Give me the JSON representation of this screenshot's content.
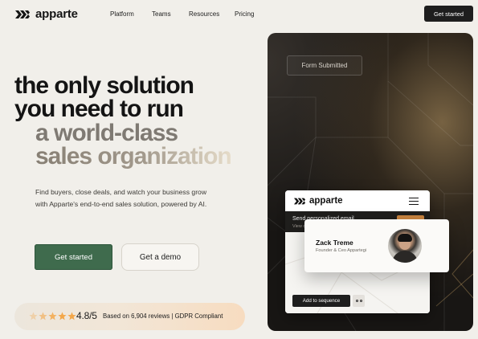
{
  "nav": {
    "brand": "apparte",
    "links": [
      "Platform",
      "Teams",
      "Resources",
      "Pricing"
    ],
    "cta": "Get started"
  },
  "hero": {
    "headline": [
      "the only solution",
      "you need to run",
      "a world-class",
      "sales organization"
    ],
    "subtext": "Find buyers, close deals, and watch your business grow with Apparte's end-to-end sales solution, powered by AI.",
    "primary_button": "Get started",
    "secondary_button": "Get a demo"
  },
  "reviews": {
    "rating": "4.8/5",
    "text": "Based on 6,904 reviews | GDPR Compliant",
    "star_count": 5
  },
  "visual": {
    "form_chip": "Form Submitted",
    "app_brand": "apparte",
    "strip_title": "Send personalized email",
    "strip_subtitle": "View details",
    "profile_name": "Zack Treme",
    "profile_role": "Founder & Ceo Appartegi",
    "sequence_button": "Add to sequence"
  },
  "colors": {
    "background": "#f1efea",
    "primary_green": "#3f6b4d",
    "dark": "#1e1e1e",
    "accent_gold": "#c8833f"
  }
}
